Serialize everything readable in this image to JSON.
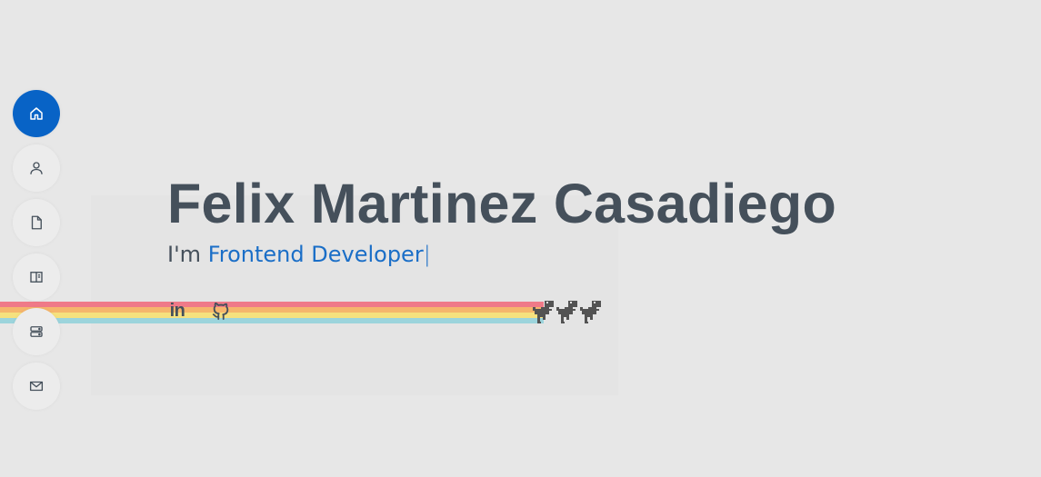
{
  "nav": {
    "items": [
      {
        "icon": "home-icon",
        "active": true
      },
      {
        "icon": "user-icon",
        "active": false
      },
      {
        "icon": "file-icon",
        "active": false
      },
      {
        "icon": "book-icon",
        "active": false
      },
      {
        "icon": "server-icon",
        "active": false
      },
      {
        "icon": "envelope-icon",
        "active": false
      }
    ],
    "active_color": "#0863c6",
    "inactive_color": "#ececec"
  },
  "hero": {
    "name": "Felix Martinez Casadiego",
    "prefix": "I'm",
    "role": "Frontend Developer",
    "cursor": "|"
  },
  "social": {
    "linkedin_label": "in",
    "links": [
      {
        "icon": "linkedin-icon"
      },
      {
        "icon": "github-icon"
      }
    ]
  },
  "colors": {
    "text": "#45505b",
    "accent": "#1a6ec7",
    "rainbow": [
      "#ef7a88",
      "#f5b66c",
      "#f6e17e",
      "#9cd4dc"
    ]
  }
}
